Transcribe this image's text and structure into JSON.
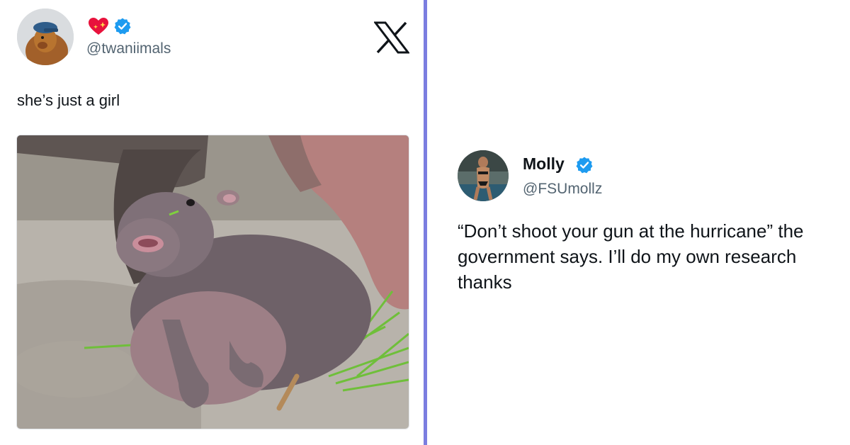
{
  "left_tweet": {
    "emoji": "heart-with-sparkles",
    "verified": true,
    "handle": "@twaniimals",
    "text": "she’s just a girl",
    "media_alt_icon": "baby-hippo-photo"
  },
  "right_tweet": {
    "name": "Molly",
    "verified": true,
    "handle": "@FSUmollz",
    "text": "“Don’t shoot your gun at the hurricane” the government says. I’ll do my own research thanks"
  },
  "colors": {
    "divider": "#7b7ee0",
    "verified_blue": "#1d9bf0",
    "handle_gray": "#536471",
    "text": "#0f1419"
  }
}
